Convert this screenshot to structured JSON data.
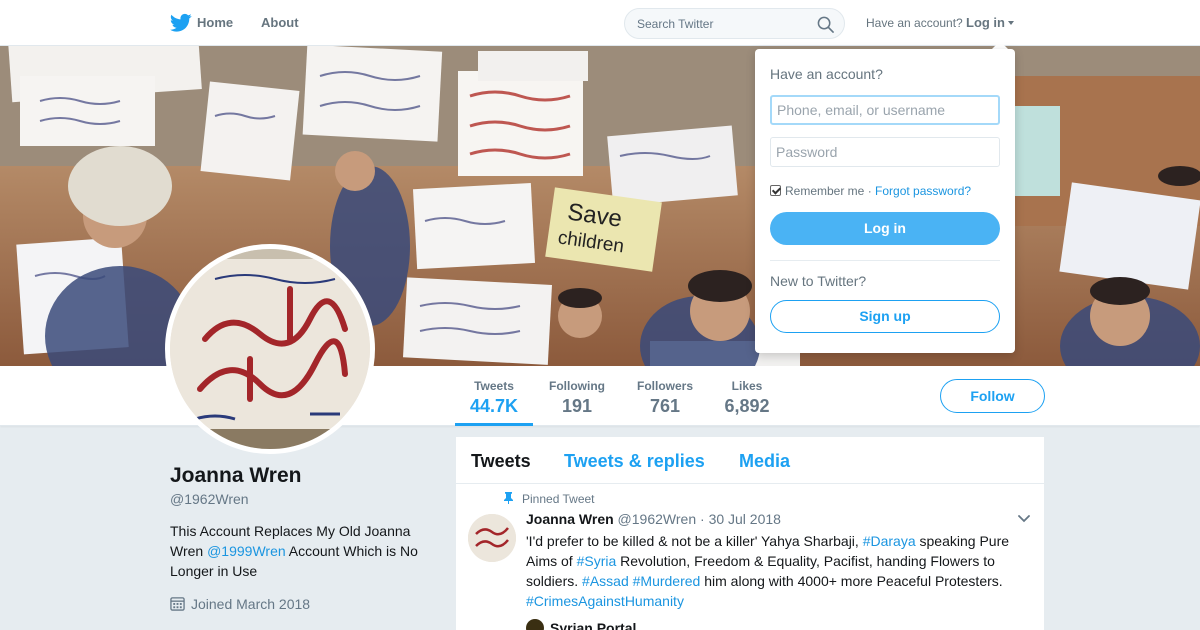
{
  "nav": {
    "home_label": "Home",
    "about_label": "About",
    "search_placeholder": "Search Twitter",
    "have_account": "Have an account?",
    "login_label": "Log in"
  },
  "profile": {
    "name": "Joanna Wren",
    "handle": "@1962Wren",
    "bio_part1": "This Account Replaces My Old Joanna Wren ",
    "bio_link": "@1999Wren",
    "bio_part2": " Account Which is No Longer in Use",
    "joined": "Joined March 2018"
  },
  "stats": [
    {
      "label": "Tweets",
      "value": "44.7K"
    },
    {
      "label": "Following",
      "value": "191"
    },
    {
      "label": "Followers",
      "value": "761"
    },
    {
      "label": "Likes",
      "value": "6,892"
    }
  ],
  "follow_label": "Follow",
  "timeline": {
    "tabs": [
      "Tweets",
      "Tweets & replies",
      "Media"
    ],
    "pinned_label": "Pinned Tweet",
    "tweet": {
      "name": "Joanna Wren",
      "handle": "@1962Wren",
      "date": "30 Jul 2018",
      "text_1": "'I'd prefer to be killed & not be a killer' Yahya Sharbaji, ",
      "tag_1": "#Daraya",
      "text_2": " speaking Pure Aims of ",
      "tag_2": "#Syria",
      "text_3": " Revolution, Freedom & Equality, Pacifist, handing Flowers to soldiers. ",
      "tag_3": "#Assad",
      "tag_4": "#Murdered",
      "text_4": " him along with 4000+ more Peaceful Protesters. ",
      "tag_5": "#CrimesAgainstHumanity",
      "quote_name": "Syrian Portal"
    }
  },
  "login_dropdown": {
    "title": "Have an account?",
    "username_placeholder": "Phone, email, or username",
    "password_placeholder": "Password",
    "remember_label": "Remember me",
    "forgot_label": "Forgot password?",
    "login_button": "Log in",
    "new_label": "New to Twitter?",
    "signup_button": "Sign up"
  },
  "banner": {
    "sign_text": "Save children"
  },
  "colors": {
    "accent": "#1da1f2",
    "link": "#1b95e0",
    "background": "#e6ecf0"
  },
  "icons": [
    "twitter-bird-icon",
    "search-icon",
    "caret-down-icon",
    "calendar-icon",
    "pin-icon",
    "chevron-down-icon"
  ]
}
